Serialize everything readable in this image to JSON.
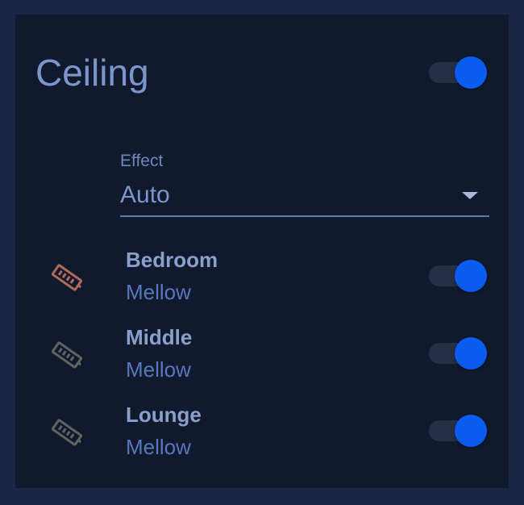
{
  "header": {
    "title": "Ceiling",
    "enabled": true
  },
  "effect": {
    "label": "Effect",
    "selected": "Auto"
  },
  "lights": [
    {
      "name": "Bedroom",
      "effect": "Mellow",
      "on": true,
      "icon": "light-strip-icon",
      "icon_color": "#b06a5a"
    },
    {
      "name": "Middle",
      "effect": "Mellow",
      "on": true,
      "icon": "light-strip-icon",
      "icon_color": "#5e6460"
    },
    {
      "name": "Lounge",
      "effect": "Mellow",
      "on": true,
      "icon": "light-strip-icon",
      "icon_color": "#5e6460"
    }
  ],
  "colors": {
    "background": "#1a2744",
    "card": "#111a2c",
    "accent": "#0b5cf1",
    "title": "#7b96cc",
    "secondary": "#5678c0"
  }
}
